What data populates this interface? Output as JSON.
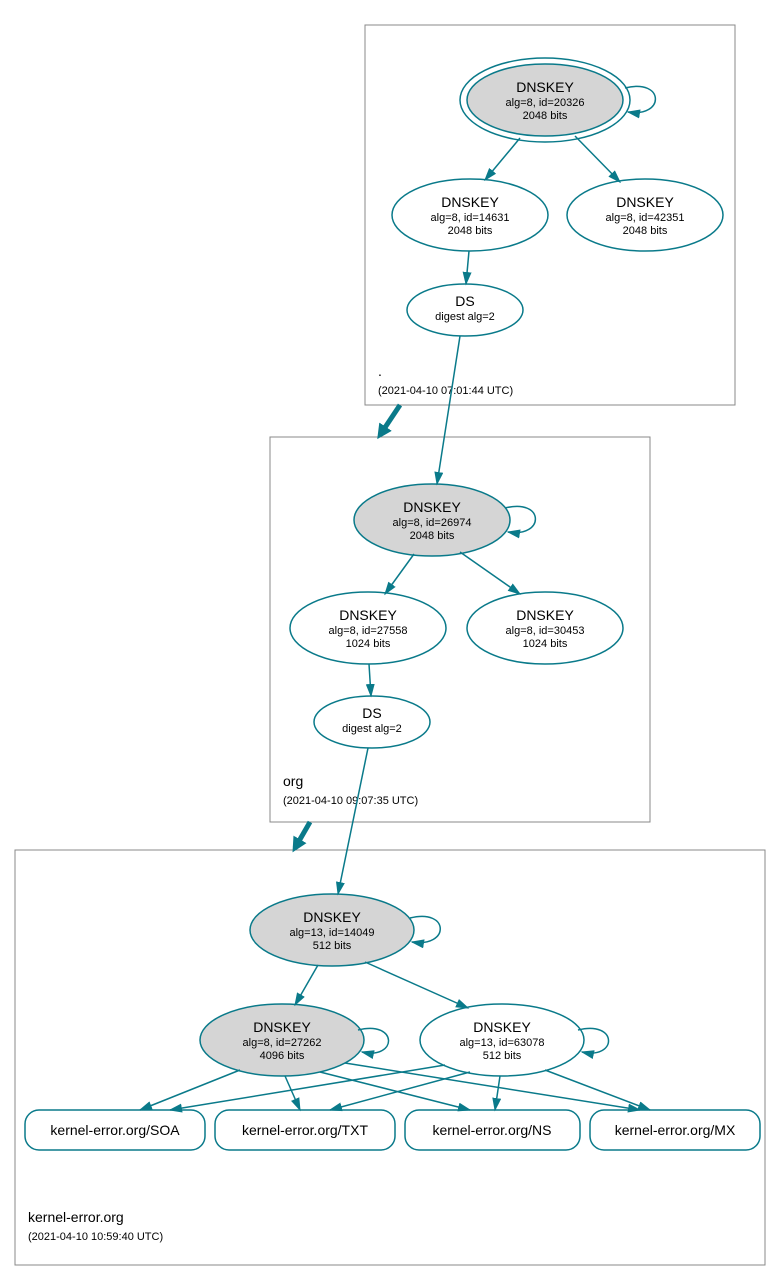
{
  "zones": {
    "root": {
      "label": ".",
      "timestamp": "(2021-04-10 07:01:44 UTC)"
    },
    "org": {
      "label": "org",
      "timestamp": "(2021-04-10 09:07:35 UTC)"
    },
    "domain": {
      "label": "kernel-error.org",
      "timestamp": "(2021-04-10 10:59:40 UTC)"
    }
  },
  "nodes": {
    "root_ksk": {
      "title": "DNSKEY",
      "sub1": "alg=8, id=20326",
      "sub2": "2048 bits"
    },
    "root_zsk1": {
      "title": "DNSKEY",
      "sub1": "alg=8, id=14631",
      "sub2": "2048 bits"
    },
    "root_zsk2": {
      "title": "DNSKEY",
      "sub1": "alg=8, id=42351",
      "sub2": "2048 bits"
    },
    "root_ds": {
      "title": "DS",
      "sub1": "digest alg=2"
    },
    "org_ksk": {
      "title": "DNSKEY",
      "sub1": "alg=8, id=26974",
      "sub2": "2048 bits"
    },
    "org_zsk1": {
      "title": "DNSKEY",
      "sub1": "alg=8, id=27558",
      "sub2": "1024 bits"
    },
    "org_zsk2": {
      "title": "DNSKEY",
      "sub1": "alg=8, id=30453",
      "sub2": "1024 bits"
    },
    "org_ds": {
      "title": "DS",
      "sub1": "digest alg=2"
    },
    "dom_ksk": {
      "title": "DNSKEY",
      "sub1": "alg=13, id=14049",
      "sub2": "512 bits"
    },
    "dom_key1": {
      "title": "DNSKEY",
      "sub1": "alg=8, id=27262",
      "sub2": "4096 bits"
    },
    "dom_key2": {
      "title": "DNSKEY",
      "sub1": "alg=13, id=63078",
      "sub2": "512 bits"
    },
    "rr_soa": {
      "label": "kernel-error.org/SOA"
    },
    "rr_txt": {
      "label": "kernel-error.org/TXT"
    },
    "rr_ns": {
      "label": "kernel-error.org/NS"
    },
    "rr_mx": {
      "label": "kernel-error.org/MX"
    }
  },
  "colors": {
    "teal": "#0a7a8a",
    "gray": "#d5d5d5"
  }
}
